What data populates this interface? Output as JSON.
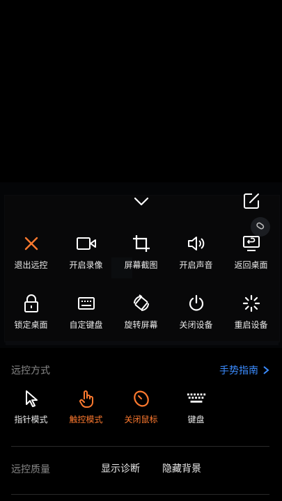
{
  "controls": [
    {
      "label": "退出远控",
      "icon": "close-icon"
    },
    {
      "label": "开启录像",
      "icon": "video-icon"
    },
    {
      "label": "屏幕截图",
      "icon": "crop-icon"
    },
    {
      "label": "开启声音",
      "icon": "speaker-icon"
    },
    {
      "label": "返回桌面",
      "icon": "desktop-return-icon"
    },
    {
      "label": "锁定桌面",
      "icon": "lock-icon"
    },
    {
      "label": "自定键盘",
      "icon": "keyboard-icon"
    },
    {
      "label": "旋转屏幕",
      "icon": "rotate-icon"
    },
    {
      "label": "关闭设备",
      "icon": "power-icon"
    },
    {
      "label": "重启设备",
      "icon": "restart-icon"
    }
  ],
  "remote_mode": {
    "title": "远控方式",
    "guide_label": "手势指南",
    "modes": [
      {
        "label": "指针模式",
        "icon": "pointer-icon"
      },
      {
        "label": "触控模式",
        "icon": "touch-icon",
        "active": true
      },
      {
        "label": "关闭鼠标",
        "icon": "mouse-off-icon",
        "active": true
      },
      {
        "label": "键盘",
        "icon": "keyboard-icon"
      }
    ]
  },
  "quality": {
    "title": "远控质量",
    "show_diag": "显示诊断",
    "hide_bg": "隐藏背景"
  },
  "colors": {
    "accent": "#ff7a2f",
    "link": "#3b8cff",
    "text": "#e9e9e9",
    "muted": "#8a8a8a"
  }
}
